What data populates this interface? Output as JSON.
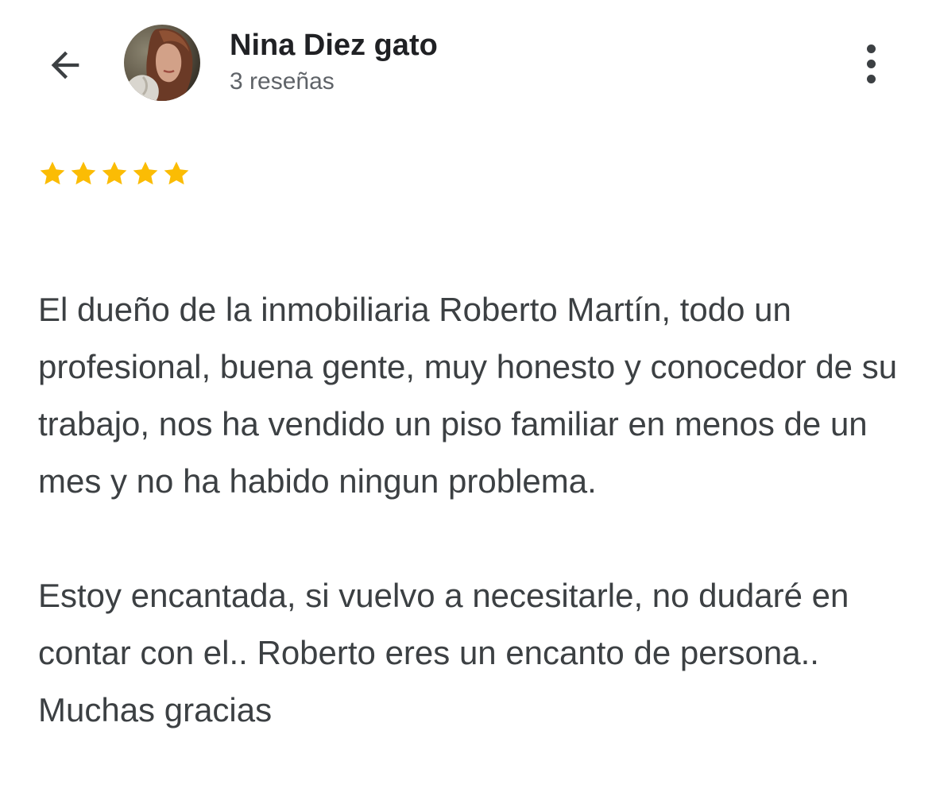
{
  "header": {
    "back_icon": "arrow-left-icon",
    "user_name": "Nina Diez gato",
    "review_count": "3 reseñas",
    "more_icon": "more-vertical-icon"
  },
  "review": {
    "rating": 5,
    "rating_max": 5,
    "star_color": "#fbbc04",
    "paragraphs": [
      "El dueño de la inmobiliaria Roberto Martín, todo un profesional, buena gente, muy honesto y conocedor de su trabajo, nos ha vendido un piso familiar en menos de un mes y no ha habido ningun problema.",
      "Estoy encantada, si vuelvo a necesitarle, no dudaré en contar con el.. Roberto eres un encanto de persona.. Muchas gracias"
    ]
  }
}
